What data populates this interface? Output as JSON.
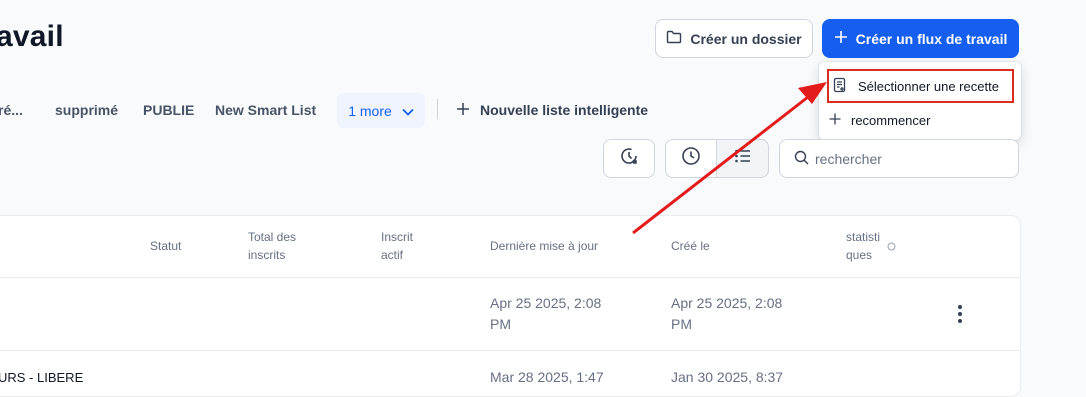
{
  "header": {
    "title_fragment": "avail",
    "create_folder_label": "Créer un dossier",
    "create_workflow_label": "Créer un flux de travail"
  },
  "dropdown": {
    "items": [
      {
        "label": "Sélectionner une recette",
        "icon": "recipe-icon"
      },
      {
        "label": "recommencer",
        "icon": "plus-icon"
      }
    ]
  },
  "tabs": {
    "items": [
      "ré...",
      "supprimé",
      "PUBLIE",
      "New Smart List"
    ],
    "more_label": "1 more",
    "new_list_label": "Nouvelle liste intelligente"
  },
  "toolbar": {
    "search_placeholder": "rechercher"
  },
  "table": {
    "headers": {
      "status": "Statut",
      "total_line1": "Total des",
      "total_line2": "inscrits",
      "active_line1": "Inscrit",
      "active_line2": "actif",
      "updated": "Dernière mise à jour",
      "created": "Créé le",
      "stats_line1": "statisti",
      "stats_line2": "ques"
    },
    "rows": [
      {
        "name": "",
        "updated_line1": "Apr 25 2025, 2:08",
        "updated_line2": "PM",
        "created_line1": "Apr 25 2025, 2:08",
        "created_line2": "PM"
      },
      {
        "name": "URS - LIBERE",
        "updated_line1": "Mar 28 2025, 1:47",
        "created_line1": "Jan 30 2025, 8:37"
      }
    ]
  },
  "colors": {
    "primary": "#155eef",
    "annotation_red": "#e31b1b"
  }
}
